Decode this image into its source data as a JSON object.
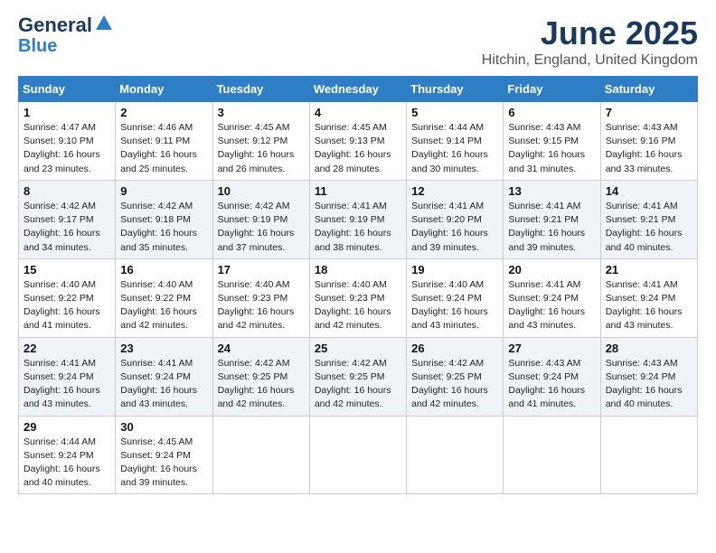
{
  "logo": {
    "line1": "General",
    "line2": "Blue"
  },
  "title": "June 2025",
  "location": "Hitchin, England, United Kingdom",
  "days_of_week": [
    "Sunday",
    "Monday",
    "Tuesday",
    "Wednesday",
    "Thursday",
    "Friday",
    "Saturday"
  ],
  "weeks": [
    [
      {
        "day": 1,
        "info": "Sunrise: 4:47 AM\nSunset: 9:10 PM\nDaylight: 16 hours\nand 23 minutes."
      },
      {
        "day": 2,
        "info": "Sunrise: 4:46 AM\nSunset: 9:11 PM\nDaylight: 16 hours\nand 25 minutes."
      },
      {
        "day": 3,
        "info": "Sunrise: 4:45 AM\nSunset: 9:12 PM\nDaylight: 16 hours\nand 26 minutes."
      },
      {
        "day": 4,
        "info": "Sunrise: 4:45 AM\nSunset: 9:13 PM\nDaylight: 16 hours\nand 28 minutes."
      },
      {
        "day": 5,
        "info": "Sunrise: 4:44 AM\nSunset: 9:14 PM\nDaylight: 16 hours\nand 30 minutes."
      },
      {
        "day": 6,
        "info": "Sunrise: 4:43 AM\nSunset: 9:15 PM\nDaylight: 16 hours\nand 31 minutes."
      },
      {
        "day": 7,
        "info": "Sunrise: 4:43 AM\nSunset: 9:16 PM\nDaylight: 16 hours\nand 33 minutes."
      }
    ],
    [
      {
        "day": 8,
        "info": "Sunrise: 4:42 AM\nSunset: 9:17 PM\nDaylight: 16 hours\nand 34 minutes."
      },
      {
        "day": 9,
        "info": "Sunrise: 4:42 AM\nSunset: 9:18 PM\nDaylight: 16 hours\nand 35 minutes."
      },
      {
        "day": 10,
        "info": "Sunrise: 4:42 AM\nSunset: 9:19 PM\nDaylight: 16 hours\nand 37 minutes."
      },
      {
        "day": 11,
        "info": "Sunrise: 4:41 AM\nSunset: 9:19 PM\nDaylight: 16 hours\nand 38 minutes."
      },
      {
        "day": 12,
        "info": "Sunrise: 4:41 AM\nSunset: 9:20 PM\nDaylight: 16 hours\nand 39 minutes."
      },
      {
        "day": 13,
        "info": "Sunrise: 4:41 AM\nSunset: 9:21 PM\nDaylight: 16 hours\nand 39 minutes."
      },
      {
        "day": 14,
        "info": "Sunrise: 4:41 AM\nSunset: 9:21 PM\nDaylight: 16 hours\nand 40 minutes."
      }
    ],
    [
      {
        "day": 15,
        "info": "Sunrise: 4:40 AM\nSunset: 9:22 PM\nDaylight: 16 hours\nand 41 minutes."
      },
      {
        "day": 16,
        "info": "Sunrise: 4:40 AM\nSunset: 9:22 PM\nDaylight: 16 hours\nand 42 minutes."
      },
      {
        "day": 17,
        "info": "Sunrise: 4:40 AM\nSunset: 9:23 PM\nDaylight: 16 hours\nand 42 minutes."
      },
      {
        "day": 18,
        "info": "Sunrise: 4:40 AM\nSunset: 9:23 PM\nDaylight: 16 hours\nand 42 minutes."
      },
      {
        "day": 19,
        "info": "Sunrise: 4:40 AM\nSunset: 9:24 PM\nDaylight: 16 hours\nand 43 minutes."
      },
      {
        "day": 20,
        "info": "Sunrise: 4:41 AM\nSunset: 9:24 PM\nDaylight: 16 hours\nand 43 minutes."
      },
      {
        "day": 21,
        "info": "Sunrise: 4:41 AM\nSunset: 9:24 PM\nDaylight: 16 hours\nand 43 minutes."
      }
    ],
    [
      {
        "day": 22,
        "info": "Sunrise: 4:41 AM\nSunset: 9:24 PM\nDaylight: 16 hours\nand 43 minutes."
      },
      {
        "day": 23,
        "info": "Sunrise: 4:41 AM\nSunset: 9:24 PM\nDaylight: 16 hours\nand 43 minutes."
      },
      {
        "day": 24,
        "info": "Sunrise: 4:42 AM\nSunset: 9:25 PM\nDaylight: 16 hours\nand 42 minutes."
      },
      {
        "day": 25,
        "info": "Sunrise: 4:42 AM\nSunset: 9:25 PM\nDaylight: 16 hours\nand 42 minutes."
      },
      {
        "day": 26,
        "info": "Sunrise: 4:42 AM\nSunset: 9:25 PM\nDaylight: 16 hours\nand 42 minutes."
      },
      {
        "day": 27,
        "info": "Sunrise: 4:43 AM\nSunset: 9:24 PM\nDaylight: 16 hours\nand 41 minutes."
      },
      {
        "day": 28,
        "info": "Sunrise: 4:43 AM\nSunset: 9:24 PM\nDaylight: 16 hours\nand 40 minutes."
      }
    ],
    [
      {
        "day": 29,
        "info": "Sunrise: 4:44 AM\nSunset: 9:24 PM\nDaylight: 16 hours\nand 40 minutes."
      },
      {
        "day": 30,
        "info": "Sunrise: 4:45 AM\nSunset: 9:24 PM\nDaylight: 16 hours\nand 39 minutes."
      },
      null,
      null,
      null,
      null,
      null
    ]
  ]
}
